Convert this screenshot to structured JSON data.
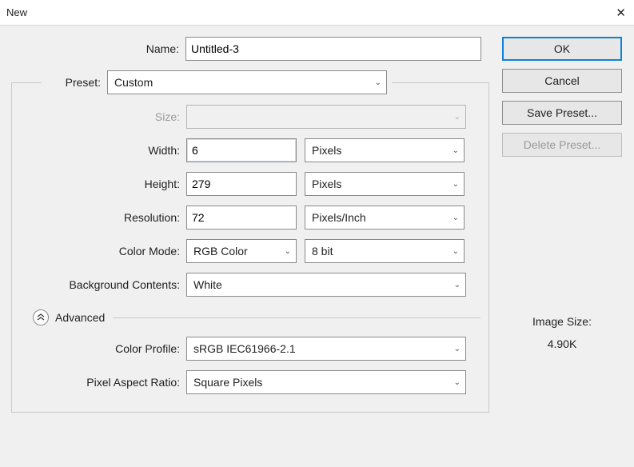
{
  "window": {
    "title": "New"
  },
  "labels": {
    "name": "Name:",
    "preset": "Preset:",
    "size": "Size:",
    "width": "Width:",
    "height": "Height:",
    "resolution": "Resolution:",
    "color_mode": "Color Mode:",
    "bg_contents": "Background Contents:",
    "advanced": "Advanced",
    "color_profile": "Color Profile:",
    "pixel_aspect": "Pixel Aspect Ratio:",
    "image_size": "Image Size:"
  },
  "fields": {
    "name": "Untitled-3",
    "preset": "Custom",
    "size": "",
    "width": "6",
    "width_unit": "Pixels",
    "height": "279",
    "height_unit": "Pixels",
    "resolution": "72",
    "resolution_unit": "Pixels/Inch",
    "color_mode": "RGB Color",
    "color_depth": "8 bit",
    "bg_contents": "White",
    "color_profile": "sRGB IEC61966-2.1",
    "pixel_aspect": "Square Pixels"
  },
  "buttons": {
    "ok": "OK",
    "cancel": "Cancel",
    "save_preset": "Save Preset...",
    "delete_preset": "Delete Preset..."
  },
  "info": {
    "image_size_value": "4.90K"
  }
}
